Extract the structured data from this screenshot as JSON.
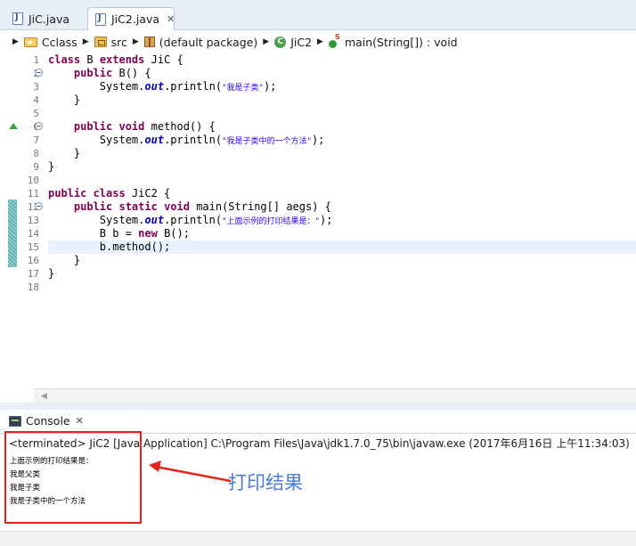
{
  "tabs": [
    {
      "label": "JiC.java",
      "active": false,
      "icon": "java-file-icon"
    },
    {
      "label": "JiC2.java",
      "active": true,
      "icon": "java-file-icon",
      "close": "✕"
    }
  ],
  "breadcrumb": [
    {
      "label": "Cclass",
      "icon": "project-icon"
    },
    {
      "label": "src",
      "icon": "source-folder-icon"
    },
    {
      "label": "(default package)",
      "icon": "package-icon"
    },
    {
      "label": "JiC2",
      "icon": "class-icon"
    },
    {
      "label": "main(String[]) : void",
      "icon": "method-icon"
    }
  ],
  "editor": {
    "line_numbers": [
      "1",
      "2",
      "3",
      "4",
      "5",
      "6",
      "7",
      "8",
      "9",
      "10",
      "11",
      "12",
      "13",
      "14",
      "15",
      "16",
      "17",
      "18"
    ],
    "lines": [
      [
        {
          "t": "class ",
          "c": "kw"
        },
        {
          "t": "B ",
          "c": "n"
        },
        {
          "t": "extends ",
          "c": "kw"
        },
        {
          "t": "JiC {",
          "c": "n"
        }
      ],
      [
        {
          "t": "    ",
          "c": "n"
        },
        {
          "t": "public ",
          "c": "kw"
        },
        {
          "t": "B() {",
          "c": "n"
        }
      ],
      [
        {
          "t": "        System.",
          "c": "n"
        },
        {
          "t": "out",
          "c": "it"
        },
        {
          "t": ".println(",
          "c": "n"
        },
        {
          "t": "\"我是子类\"",
          "c": "st"
        },
        {
          "t": ");",
          "c": "n"
        }
      ],
      [
        {
          "t": "    }",
          "c": "n"
        }
      ],
      [],
      [
        {
          "t": "    ",
          "c": "n"
        },
        {
          "t": "public ",
          "c": "kw"
        },
        {
          "t": "void ",
          "c": "kw"
        },
        {
          "t": "method() {",
          "c": "n"
        }
      ],
      [
        {
          "t": "        System.",
          "c": "n"
        },
        {
          "t": "out",
          "c": "it"
        },
        {
          "t": ".println(",
          "c": "n"
        },
        {
          "t": "\"我是子类中的一个方法\"",
          "c": "st"
        },
        {
          "t": ");",
          "c": "n"
        }
      ],
      [
        {
          "t": "    }",
          "c": "n"
        }
      ],
      [
        {
          "t": "}",
          "c": "n"
        }
      ],
      [],
      [
        {
          "t": "public ",
          "c": "kw"
        },
        {
          "t": "class ",
          "c": "kw"
        },
        {
          "t": "JiC2 {",
          "c": "n"
        }
      ],
      [
        {
          "t": "    ",
          "c": "n"
        },
        {
          "t": "public ",
          "c": "kw"
        },
        {
          "t": "static ",
          "c": "kw"
        },
        {
          "t": "void ",
          "c": "kw"
        },
        {
          "t": "main(String[] aegs) {",
          "c": "n"
        }
      ],
      [
        {
          "t": "        System.",
          "c": "n"
        },
        {
          "t": "out",
          "c": "it"
        },
        {
          "t": ".println(",
          "c": "n"
        },
        {
          "t": "\"上面示例的打印结果是：\"",
          "c": "st"
        },
        {
          "t": ");",
          "c": "n"
        }
      ],
      [
        {
          "t": "        B b = ",
          "c": "n"
        },
        {
          "t": "new ",
          "c": "kw"
        },
        {
          "t": "B();",
          "c": "n"
        }
      ],
      [
        {
          "t": "        b.method();",
          "c": "n"
        }
      ],
      [
        {
          "t": "    }",
          "c": "n"
        }
      ],
      [
        {
          "t": "}",
          "c": "n"
        }
      ],
      []
    ]
  },
  "console": {
    "tab_label": "Console",
    "tab_close": "✕",
    "terminated": "<terminated> JiC2 [Java Application] C:\\Program Files\\Java\\jdk1.7.0_75\\bin\\javaw.exe (2017年6月16日 上午11:34:03)",
    "output": [
      "上面示例的打印结果是：",
      "我是父类",
      "我是子类",
      "我是子类中的一个方法"
    ]
  },
  "annotation": {
    "text": "打印结果",
    "color": "#e2231a",
    "text_color": "#4a7bd4"
  },
  "colors": {
    "keyword": "#7f0055",
    "string": "#2a00ff",
    "field": "#0000c0",
    "current_line": "#e8f2fe",
    "chrome": "#e8eef8"
  }
}
